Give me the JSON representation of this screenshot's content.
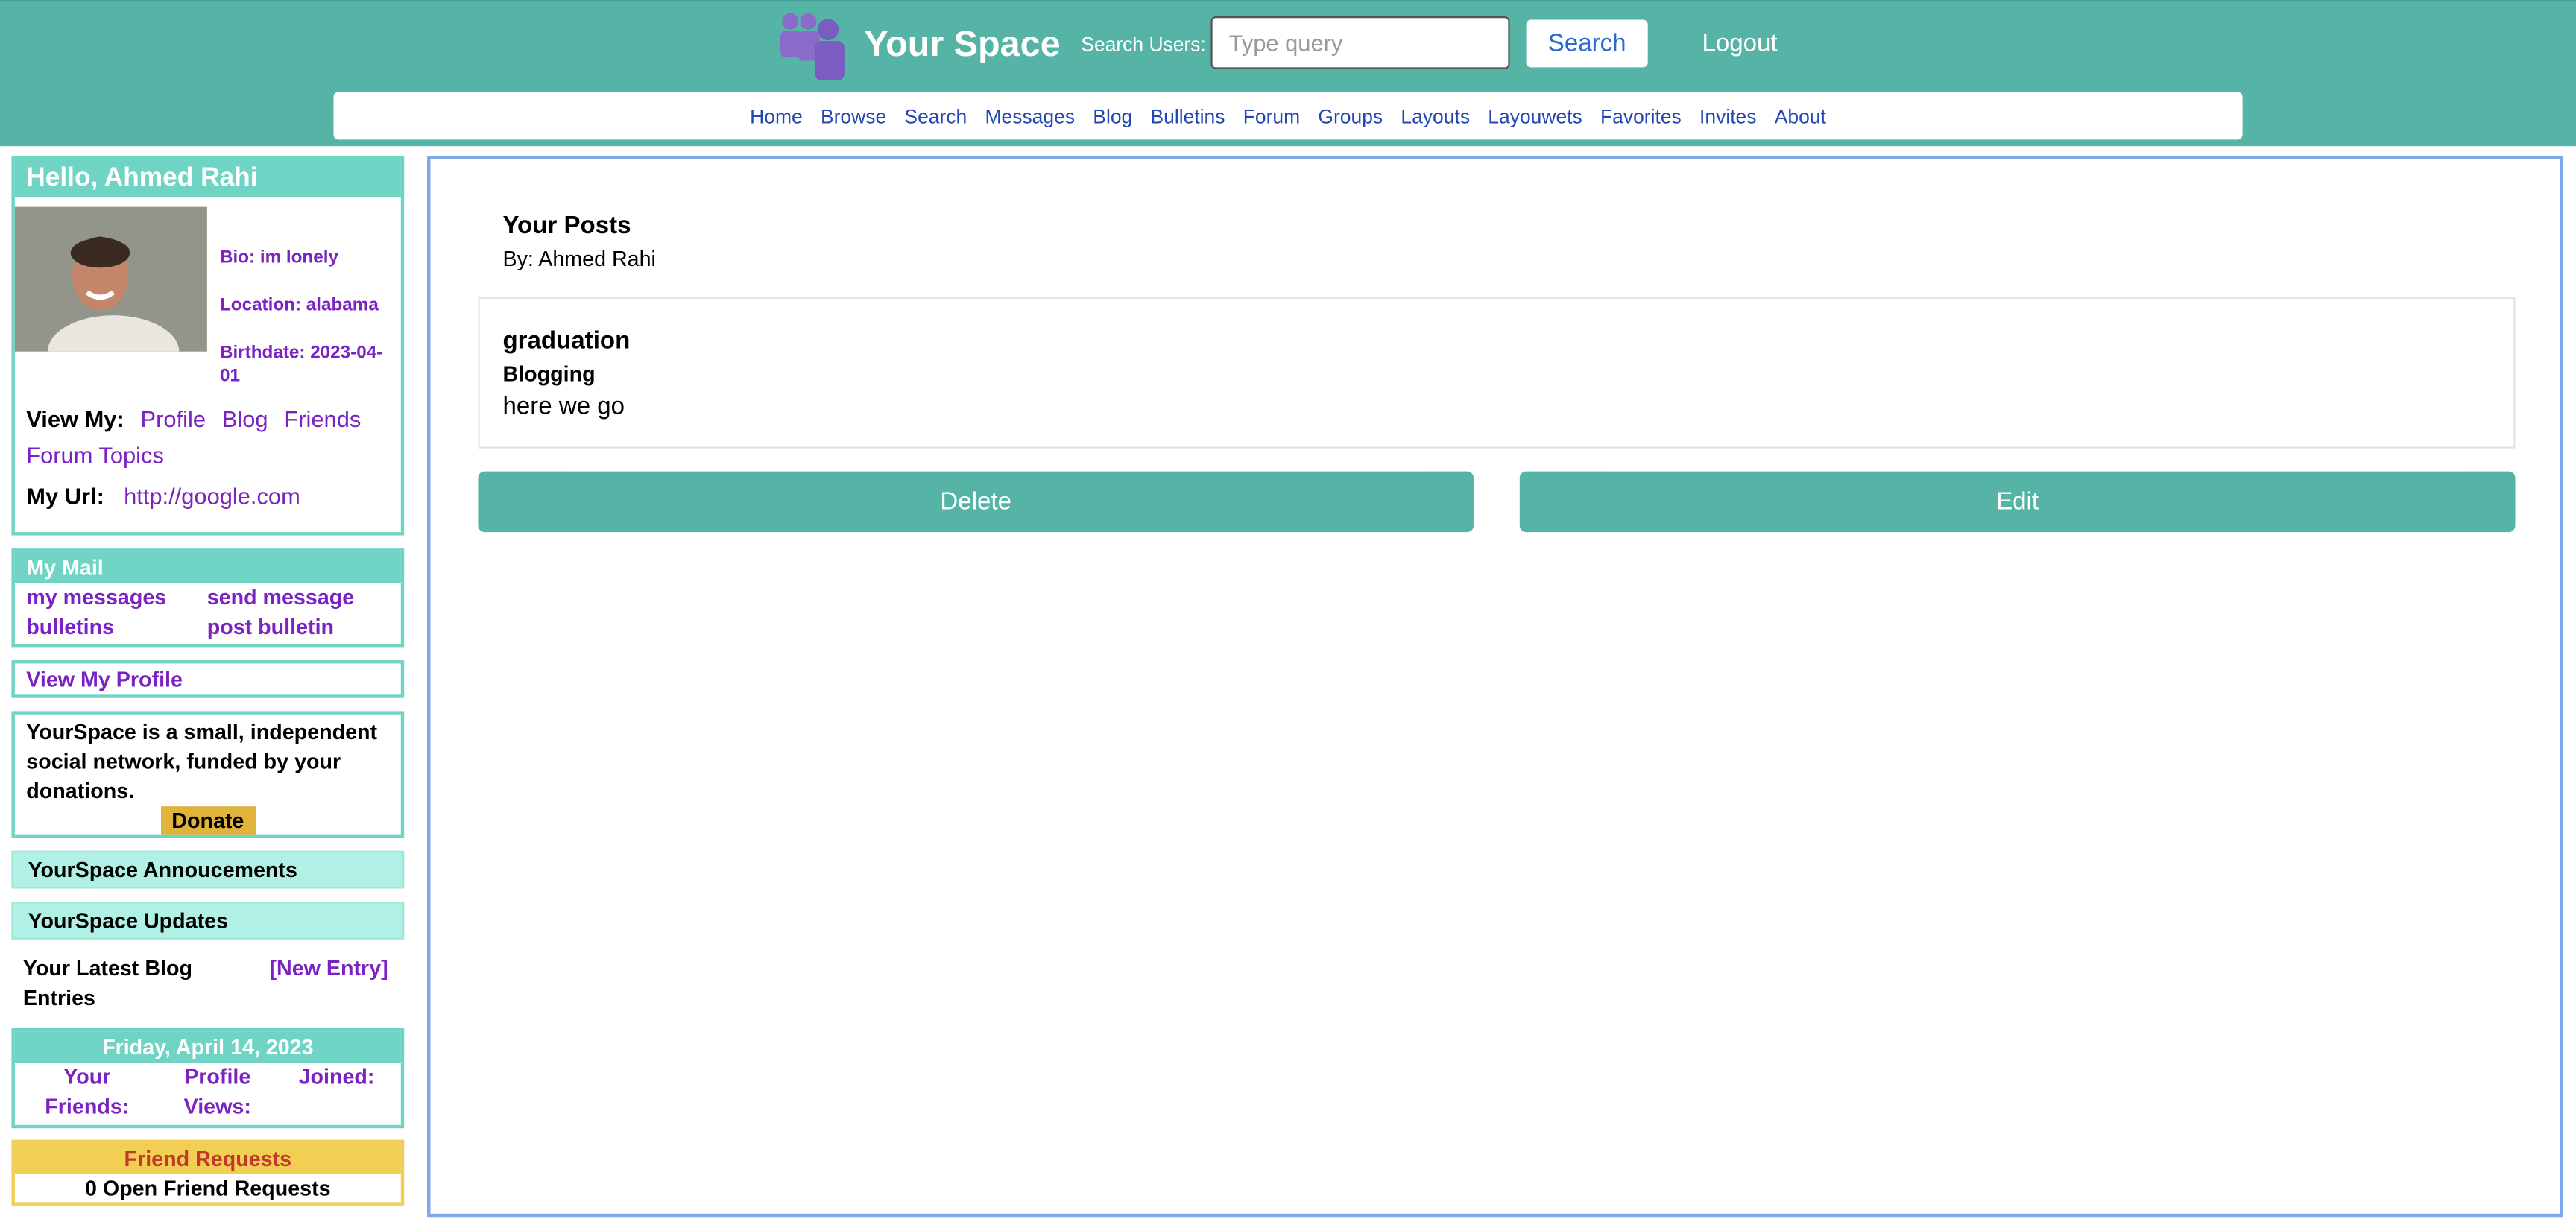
{
  "header": {
    "brand": "Your Space",
    "search_label": "Search Users:",
    "search_placeholder": "Type query",
    "search_button": "Search",
    "logout": "Logout"
  },
  "nav": [
    "Home",
    "Browse",
    "Search",
    "Messages",
    "Blog",
    "Bulletins",
    "Forum",
    "Groups",
    "Layouts",
    "Layouwets",
    "Favorites",
    "Invites",
    "About"
  ],
  "profile": {
    "greeting": "Hello, Ahmed Rahi",
    "bio": "Bio: im lonely",
    "location": "Location: alabama",
    "birthdate": "Birthdate: 2023-04-01",
    "view_my_label": "View My:",
    "view_links": [
      "Profile",
      "Blog",
      "Friends",
      "Forum Topics"
    ],
    "url_label": "My Url:",
    "url": "http://google.com"
  },
  "mail": {
    "title": "My Mail",
    "links": [
      "my messages",
      "send message",
      "bulletins",
      "post bulletin"
    ]
  },
  "view_profile": "View My Profile",
  "donate": {
    "text": "YourSpace is a small, independent social network, funded by your donations.",
    "button": "Donate"
  },
  "announcements": "YourSpace Annoucements",
  "updates": "YourSpace Updates",
  "blog_entries": {
    "label": "Your Latest Blog Entries",
    "new_entry": "[New Entry]"
  },
  "stats": {
    "date": "Friday, April 14, 2023",
    "friends": "Your Friends:",
    "views": "Profile Views:",
    "joined": "Joined:"
  },
  "friend_requests": {
    "title": "Friend Requests",
    "body": "0 Open Friend Requests"
  },
  "main": {
    "title": "Your Posts",
    "by": "By: Ahmed Rahi",
    "post": {
      "title": "graduation",
      "category": "Blogging",
      "body": "here we go"
    },
    "delete_label": "Delete",
    "edit_label": "Edit"
  },
  "colors": {
    "header": "#56b4a6",
    "accent": "#6fd4c4",
    "link": "#7a22c2",
    "nav_link": "#2446b4",
    "donate": "#e0b33b",
    "friend_requests": "#f2cf52"
  }
}
